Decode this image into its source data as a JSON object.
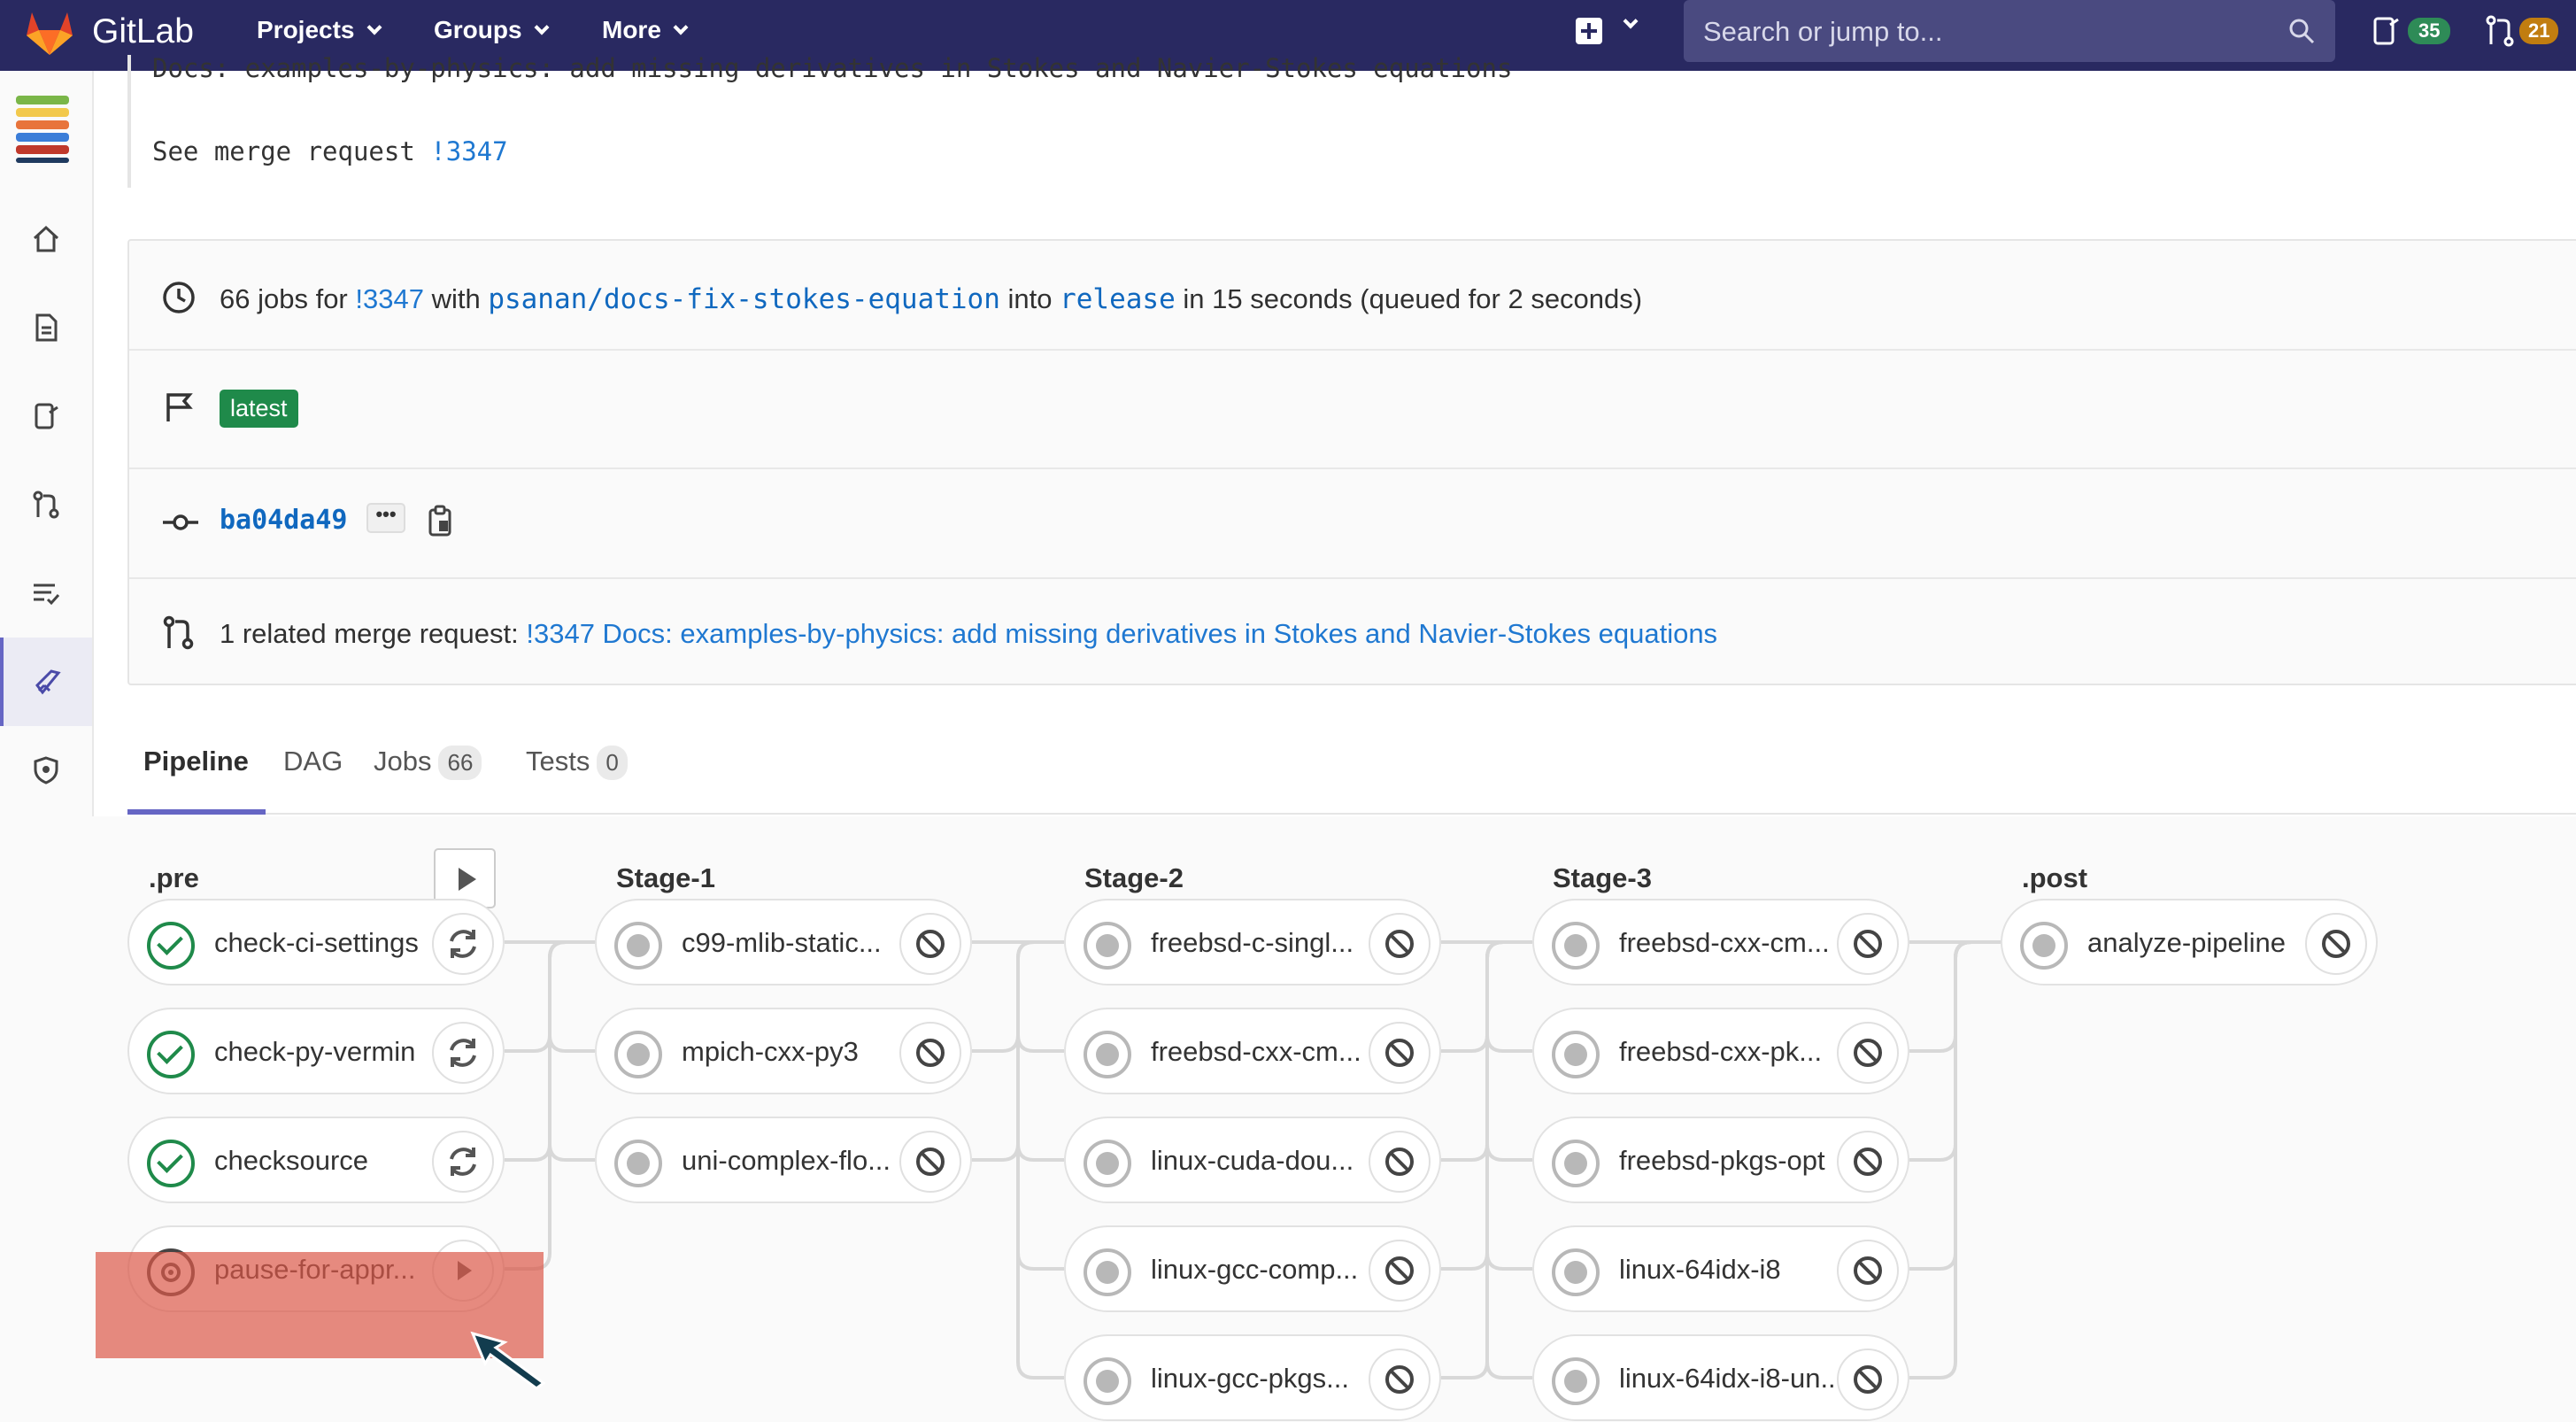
{
  "navbar": {
    "brand": "GitLab",
    "links": [
      "Projects",
      "Groups",
      "More"
    ],
    "search_placeholder": "Search or jump to...",
    "todo_count": "35",
    "mr_count": "21"
  },
  "commit": {
    "title": "Docs: examples-by-physics: add missing derivatives in Stokes and Navier-Stokes equations",
    "see_mr_prefix": "See merge request ",
    "see_mr_link": "!3347"
  },
  "info": {
    "jobs_count_text": "66 jobs for ",
    "mr_link": "!3347",
    "with_text": " with ",
    "source_branch": "psanan/docs-fix-stokes-equation",
    "into_text": " into ",
    "target_branch": "release",
    "duration_text": " in 15 seconds (queued for 2 seconds)",
    "latest_badge": "latest",
    "sha": "ba04da49",
    "ellipsis": "•••",
    "related_prefix": "1 related merge request: ",
    "related_link": "!3347 Docs: examples-by-physics: add missing derivatives in Stokes and Navier-Stokes equations"
  },
  "tabs": [
    {
      "label": "Pipeline",
      "count": ""
    },
    {
      "label": "DAG",
      "count": ""
    },
    {
      "label": "Jobs",
      "count": "66"
    },
    {
      "label": "Tests",
      "count": "0"
    }
  ],
  "stages": [
    {
      "title": ".pre",
      "jobs": [
        {
          "name": "check-ci-settings",
          "status": "success",
          "action": "retry"
        },
        {
          "name": "check-py-vermin",
          "status": "success",
          "action": "retry"
        },
        {
          "name": "checksource",
          "status": "success",
          "action": "retry"
        },
        {
          "name": "pause-for-appr...",
          "status": "manual",
          "action": "play"
        }
      ]
    },
    {
      "title": "Stage-1",
      "jobs": [
        {
          "name": "c99-mlib-static...",
          "status": "created",
          "action": "cancel"
        },
        {
          "name": "mpich-cxx-py3",
          "status": "created",
          "action": "cancel"
        },
        {
          "name": "uni-complex-flo...",
          "status": "created",
          "action": "cancel"
        }
      ]
    },
    {
      "title": "Stage-2",
      "jobs": [
        {
          "name": "freebsd-c-singl...",
          "status": "created",
          "action": "cancel"
        },
        {
          "name": "freebsd-cxx-cm...",
          "status": "created",
          "action": "cancel"
        },
        {
          "name": "linux-cuda-dou...",
          "status": "created",
          "action": "cancel"
        },
        {
          "name": "linux-gcc-comp...",
          "status": "created",
          "action": "cancel"
        },
        {
          "name": "linux-gcc-pkgs...",
          "status": "created",
          "action": "cancel"
        }
      ]
    },
    {
      "title": "Stage-3",
      "jobs": [
        {
          "name": "freebsd-cxx-cm...",
          "status": "created",
          "action": "cancel"
        },
        {
          "name": "freebsd-cxx-pk...",
          "status": "created",
          "action": "cancel"
        },
        {
          "name": "freebsd-pkgs-opt",
          "status": "created",
          "action": "cancel"
        },
        {
          "name": "linux-64idx-i8",
          "status": "created",
          "action": "cancel"
        },
        {
          "name": "linux-64idx-i8-un...",
          "status": "created",
          "action": "cancel"
        }
      ]
    },
    {
      "title": ".post",
      "jobs": [
        {
          "name": "analyze-pipeline",
          "status": "created",
          "action": "cancel"
        }
      ]
    }
  ],
  "colors": {
    "navbar": "#292961",
    "link": "#1f78d1",
    "success": "#1f8a4a",
    "highlight": "#db5848"
  }
}
